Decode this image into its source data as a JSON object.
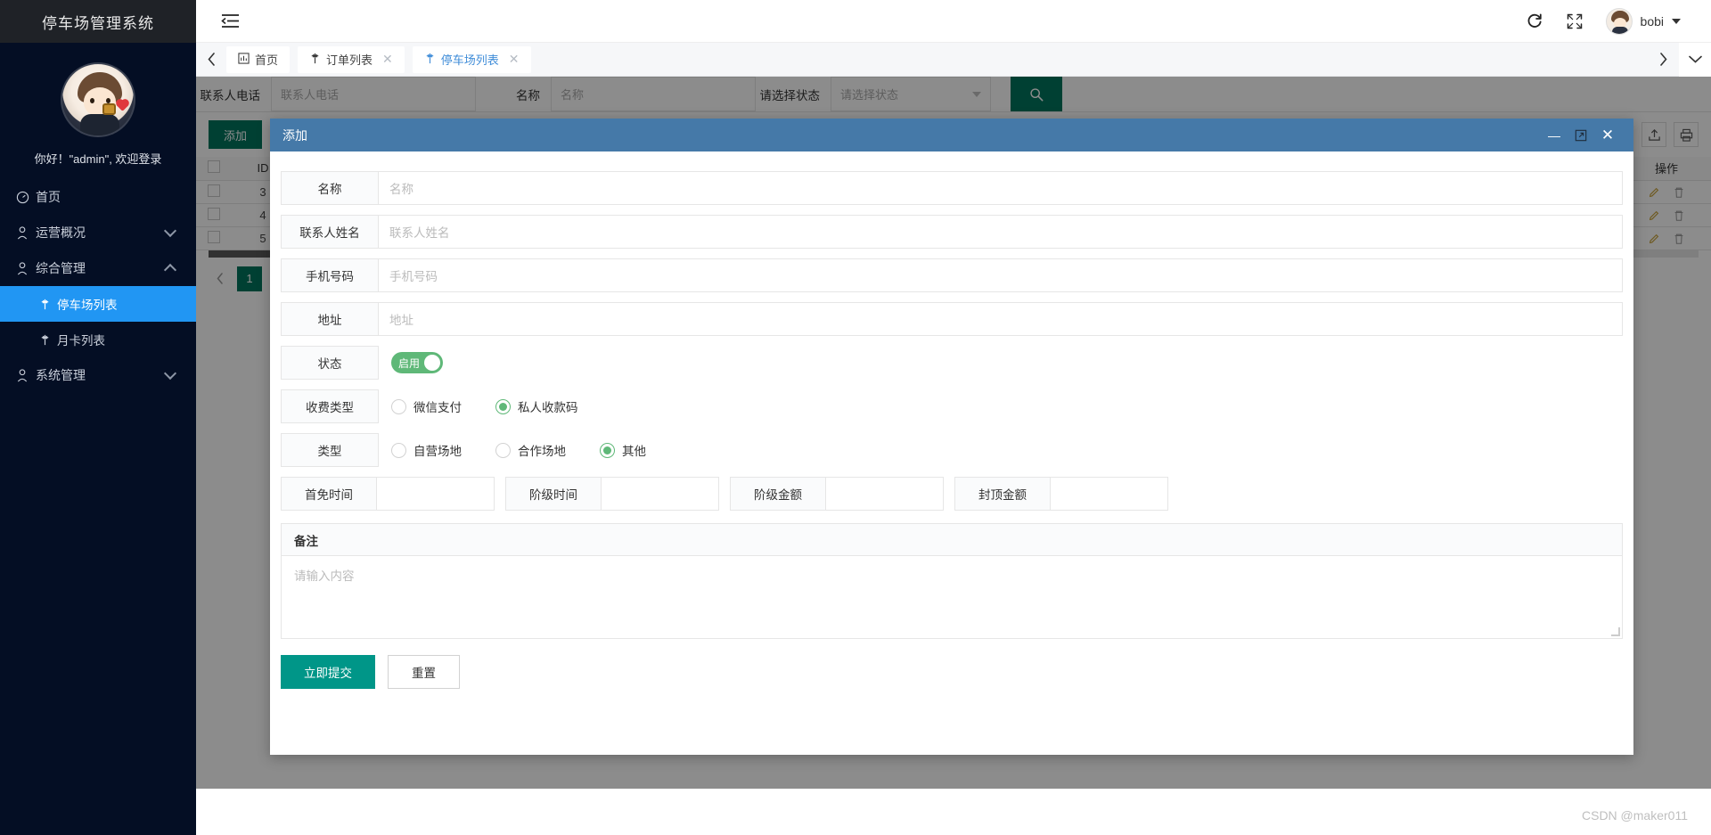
{
  "sidebar": {
    "logo": "停车场管理系统",
    "welcome": "你好！\"admin\", 欢迎登录",
    "items": [
      {
        "label": "首页",
        "icon": "gauge-icon",
        "expandable": false,
        "active": false
      },
      {
        "label": "运营概况",
        "icon": "user-icon",
        "expandable": true,
        "expanded": false
      },
      {
        "label": "综合管理",
        "icon": "user-icon",
        "expandable": true,
        "expanded": true
      },
      {
        "label": "系统管理",
        "icon": "user-icon",
        "expandable": true,
        "expanded": false
      }
    ],
    "subitems": [
      {
        "label": "停车场列表",
        "icon": "pin-icon",
        "active": true
      },
      {
        "label": "月卡列表",
        "icon": "pin-icon",
        "active": false
      }
    ]
  },
  "header": {
    "collapse_icon": "menu-collapse-icon",
    "refresh_icon": "refresh-icon",
    "fullscreen_icon": "fullscreen-icon",
    "username": "bobi"
  },
  "tabbar": {
    "prev_icon": "chevron-left-icon",
    "next_icon": "chevron-right-icon",
    "more_icon": "chevron-down-icon",
    "tabs": [
      {
        "label": "首页",
        "icon": "home-chart-icon",
        "closable": false,
        "active": false
      },
      {
        "label": "订单列表",
        "icon": "pin-icon",
        "closable": true,
        "active": false
      },
      {
        "label": "停车场列表",
        "icon": "pin-icon",
        "closable": true,
        "active": true
      }
    ],
    "close_glyph": "✕"
  },
  "search": {
    "fields": [
      {
        "label": "联系人电话",
        "placeholder": "联系人电话",
        "type": "input"
      },
      {
        "label": "名称",
        "placeholder": "名称",
        "type": "input"
      },
      {
        "label": "请选择状态",
        "placeholder": "请选择状态",
        "type": "select"
      }
    ],
    "search_icon": "search-icon"
  },
  "toolbar": {
    "add_label": "添加",
    "export_icon": "export-icon",
    "print_icon": "print-icon"
  },
  "table": {
    "columns": [
      "",
      "ID",
      "操作"
    ],
    "rows": [
      {
        "id": "3"
      },
      {
        "id": "4"
      },
      {
        "id": "5"
      }
    ],
    "edit_icon": "pencil-icon",
    "delete_icon": "trash-icon"
  },
  "pagination": {
    "prev_icon": "chevron-left-icon",
    "current_page": "1"
  },
  "modal": {
    "title": "添加",
    "minimize_glyph": "—",
    "maximize_icon": "maximize-icon",
    "close_glyph": "✕",
    "text_fields": [
      {
        "label": "名称",
        "placeholder": "名称",
        "value": ""
      },
      {
        "label": "联系人姓名",
        "placeholder": "联系人姓名",
        "value": ""
      },
      {
        "label": "手机号码",
        "placeholder": "手机号码",
        "value": ""
      },
      {
        "label": "地址",
        "placeholder": "地址",
        "value": ""
      }
    ],
    "status": {
      "label": "状态",
      "switch_text": "启用",
      "on": true,
      "color": "#5FB878"
    },
    "fee_type": {
      "label": "收费类型",
      "options": [
        {
          "label": "微信支付",
          "checked": false
        },
        {
          "label": "私人收款码",
          "checked": true
        }
      ]
    },
    "venue_type": {
      "label": "类型",
      "options": [
        {
          "label": "自营场地",
          "checked": false
        },
        {
          "label": "合作场地",
          "checked": false
        },
        {
          "label": "其他",
          "checked": true
        }
      ]
    },
    "fee_fields": [
      {
        "label": "首免时间",
        "value": ""
      },
      {
        "label": "阶级时间",
        "value": ""
      },
      {
        "label": "阶级金额",
        "value": ""
      },
      {
        "label": "封顶金额",
        "value": ""
      }
    ],
    "memo": {
      "label": "备注",
      "placeholder": "请输入内容",
      "value": ""
    },
    "submit_label": "立即提交",
    "reset_label": "重置"
  },
  "watermark": "CSDN @maker011",
  "colors": {
    "sidebar_bg": "#040e24",
    "sidebar_logo_bg": "#1f2227",
    "sidebar_active": "#2196f3",
    "modal_header": "#4579a8",
    "primary_green": "#009688",
    "dark_green": "#00755e",
    "switch_green": "#5FB878",
    "tab_active_text": "#3f8cd8"
  }
}
